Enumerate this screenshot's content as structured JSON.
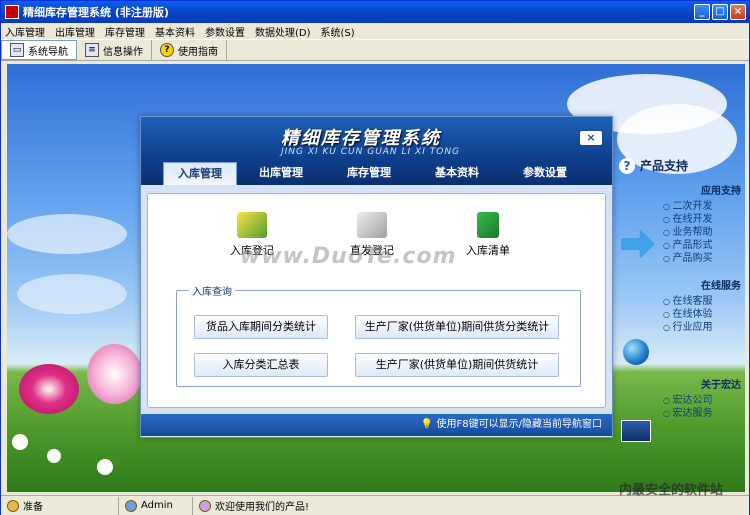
{
  "window": {
    "title": "精细库存管理系统 (非注册版)",
    "controls": [
      "_",
      "□",
      "×"
    ]
  },
  "menu": [
    "入库管理",
    "出库管理",
    "库存管理",
    "基本资料",
    "参数设置",
    "数据处理(D)",
    "系统(S)"
  ],
  "toolbar": [
    {
      "label": "系统导航",
      "icon": "monitor-icon"
    },
    {
      "label": "信息操作",
      "icon": "document-icon"
    },
    {
      "label": "使用指南",
      "icon": "help-icon"
    }
  ],
  "dialog": {
    "title": "精细库存管理系统",
    "subtitle": "JING XI KU CUN GUAN LI XI TONG",
    "close": "×",
    "tabs": [
      "入库管理",
      "出库管理",
      "库存管理",
      "基本资料",
      "参数设置"
    ],
    "actions": [
      {
        "label": "入库登记",
        "icon": "pencil-paper-icon"
      },
      {
        "label": "直发登记",
        "icon": "stamp-icon"
      },
      {
        "label": "入库清单",
        "icon": "book-icon"
      }
    ],
    "watermark": "www.DuoTe.com",
    "query_group": "入库查询",
    "query_buttons": [
      "货品入库期间分类统计",
      "生产厂家(供货单位)期间供货分类统计",
      "入库分类汇总表",
      "生产厂家(供货单位)期间供货统计"
    ],
    "footer": "使用F8键可以显示/隐藏当前导航窗口"
  },
  "side": {
    "title": "产品支持",
    "sections": [
      {
        "name": "应用支持",
        "items": [
          "二次开发",
          "在线开发",
          "业务帮助",
          "产品形式",
          "产品购买"
        ]
      },
      {
        "name": "在线服务",
        "items": [
          "在线客服",
          "在线体验",
          "行业应用"
        ]
      },
      {
        "name": "关于宏达",
        "items": [
          "宏达公司",
          "宏达服务"
        ]
      }
    ]
  },
  "status": {
    "state": "准备",
    "user": "Admin",
    "message": "欢迎使用我们的产品!"
  },
  "brand_watermark": "内最安全的软件站"
}
